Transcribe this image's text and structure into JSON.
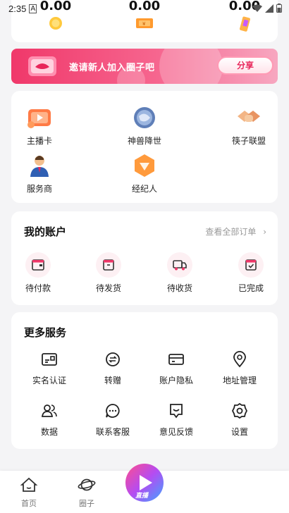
{
  "status_bar": {
    "time": "2:35"
  },
  "wallet": {
    "values": [
      "0.00",
      "0.00",
      "0.00"
    ]
  },
  "banner": {
    "text": "邀请新人加入圈子吧",
    "share_label": "分享"
  },
  "functions": [
    {
      "label": "主播卡",
      "icon": "anchor-card-icon"
    },
    {
      "label": "神兽降世",
      "icon": "globe-beast-icon"
    },
    {
      "label": "筷子联盟",
      "icon": "handshake-icon"
    },
    {
      "label": "服务商",
      "icon": "service-provider-icon"
    },
    {
      "label": "经纪人",
      "icon": "agent-gem-icon"
    }
  ],
  "account": {
    "title": "我的账户",
    "view_all": "查看全部订单",
    "orders": [
      {
        "label": "待付款",
        "icon": "wallet-icon"
      },
      {
        "label": "待发货",
        "icon": "box-icon"
      },
      {
        "label": "待收货",
        "icon": "truck-icon"
      },
      {
        "label": "已完成",
        "icon": "check-box-icon"
      }
    ]
  },
  "services": {
    "title": "更多服务",
    "items": [
      {
        "label": "实名认证",
        "icon": "id-card-icon"
      },
      {
        "label": "转赠",
        "icon": "transfer-icon"
      },
      {
        "label": "账户隐私",
        "icon": "card-icon"
      },
      {
        "label": "地址管理",
        "icon": "location-pin-icon"
      },
      {
        "label": "数据",
        "icon": "users-icon"
      },
      {
        "label": "联系客服",
        "icon": "chat-icon"
      },
      {
        "label": "意见反馈",
        "icon": "feedback-icon"
      },
      {
        "label": "设置",
        "icon": "gear-icon"
      }
    ]
  },
  "tabbar": {
    "items": [
      {
        "label": "首页",
        "icon": "home-icon"
      },
      {
        "label": "圈子",
        "icon": "planet-icon"
      }
    ],
    "live_label": "直播"
  },
  "colors": {
    "accent": "#f0386a",
    "banner_end": "#f7a7c0",
    "icon_orange": "#ff8a3d"
  }
}
